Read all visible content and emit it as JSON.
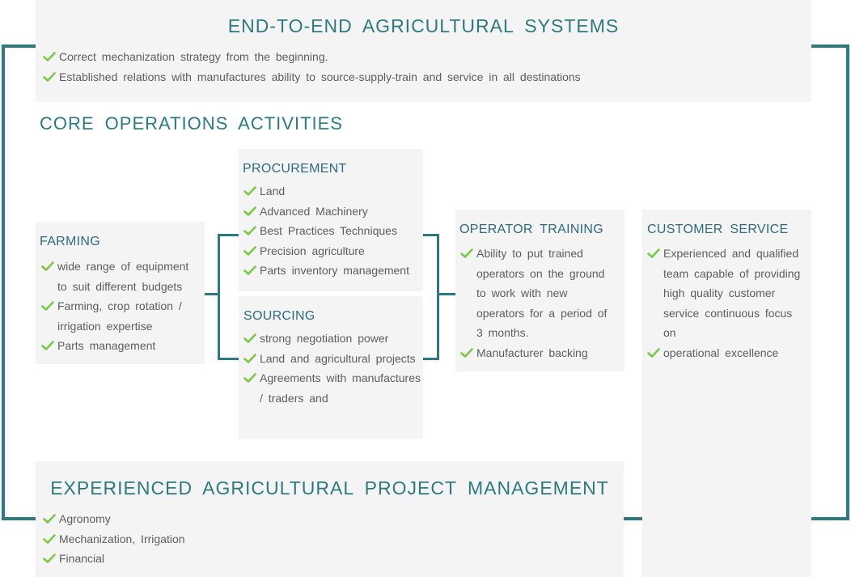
{
  "top": {
    "title": "END-TO-END AGRICULTURAL SYSTEMS",
    "items": [
      "Correct mechanization strategy from the beginning.",
      "Established relations with manufactures ability to source-supply-train and service in all destinations"
    ]
  },
  "core": {
    "title": "CORE OPERATIONS ACTIVITIES"
  },
  "farming": {
    "title": "FARMING",
    "items": [
      "wide range of equipment to suit different budgets",
      "Farming, crop rotation / irrigation expertise",
      "Parts management"
    ]
  },
  "procurement": {
    "title": "PROCUREMENT",
    "items": [
      "Land",
      "Advanced Machinery",
      "Best Practices Techniques",
      "Precision agriculture",
      "Parts inventory management"
    ]
  },
  "sourcing": {
    "title": "SOURCING",
    "items": [
      "strong negotiation power",
      "Land and agricultural projects",
      "Agreements with manufactures / traders and"
    ]
  },
  "operator_training": {
    "title": "OPERATOR TRAINING",
    "items": [
      "Ability to put trained operators on the ground to work with new operators for a period of 3 months.",
      "Manufacturer backing"
    ]
  },
  "customer_service": {
    "title": "CUSTOMER SERVICE",
    "items": [
      "Experienced and qualified team capable of providing high quality customer service continuous focus on",
      "operational excellence"
    ]
  },
  "project_management": {
    "title": "EXPERIENCED AGRICULTURAL PROJECT MANAGEMENT",
    "items": [
      "Agronomy",
      "Mechanization, Irrigation",
      "Financial"
    ]
  },
  "colors": {
    "accent": "#2d7b82",
    "check": "#7ac943",
    "panel": "#f4f4f4"
  }
}
